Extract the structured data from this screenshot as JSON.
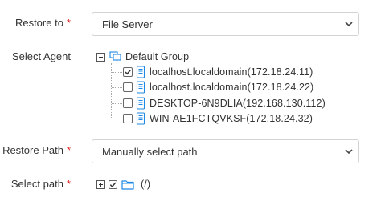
{
  "restore_to": {
    "label": "Restore to",
    "required_mark": "*",
    "value": "File Server"
  },
  "select_agent": {
    "label": "Select Agent",
    "group": {
      "label": "Default Group",
      "icon": "computer-group-icon",
      "expanded": true
    },
    "agents": [
      {
        "label": "localhost.localdomain(172.18.24.11)",
        "checked": true,
        "icon": "server-icon"
      },
      {
        "label": "localhost.localdomain(172.18.24.22)",
        "checked": false,
        "icon": "server-icon"
      },
      {
        "label": "DESKTOP-6N9DLIA(192.168.130.112)",
        "checked": false,
        "icon": "server-icon"
      },
      {
        "label": "WIN-AE1FCTQVKSF(172.18.24.32)",
        "checked": false,
        "icon": "server-icon"
      }
    ]
  },
  "restore_path": {
    "label": "Restore Path",
    "required_mark": "*",
    "value": "Manually select path"
  },
  "select_path": {
    "label": "Select path",
    "required_mark": "*",
    "root": {
      "label": "(/)",
      "checked": true,
      "expanded": false,
      "icon": "folder-icon"
    }
  },
  "colors": {
    "required": "#e0201b",
    "icon_blue": "#1e88e5",
    "border": "#d3d3d3"
  }
}
